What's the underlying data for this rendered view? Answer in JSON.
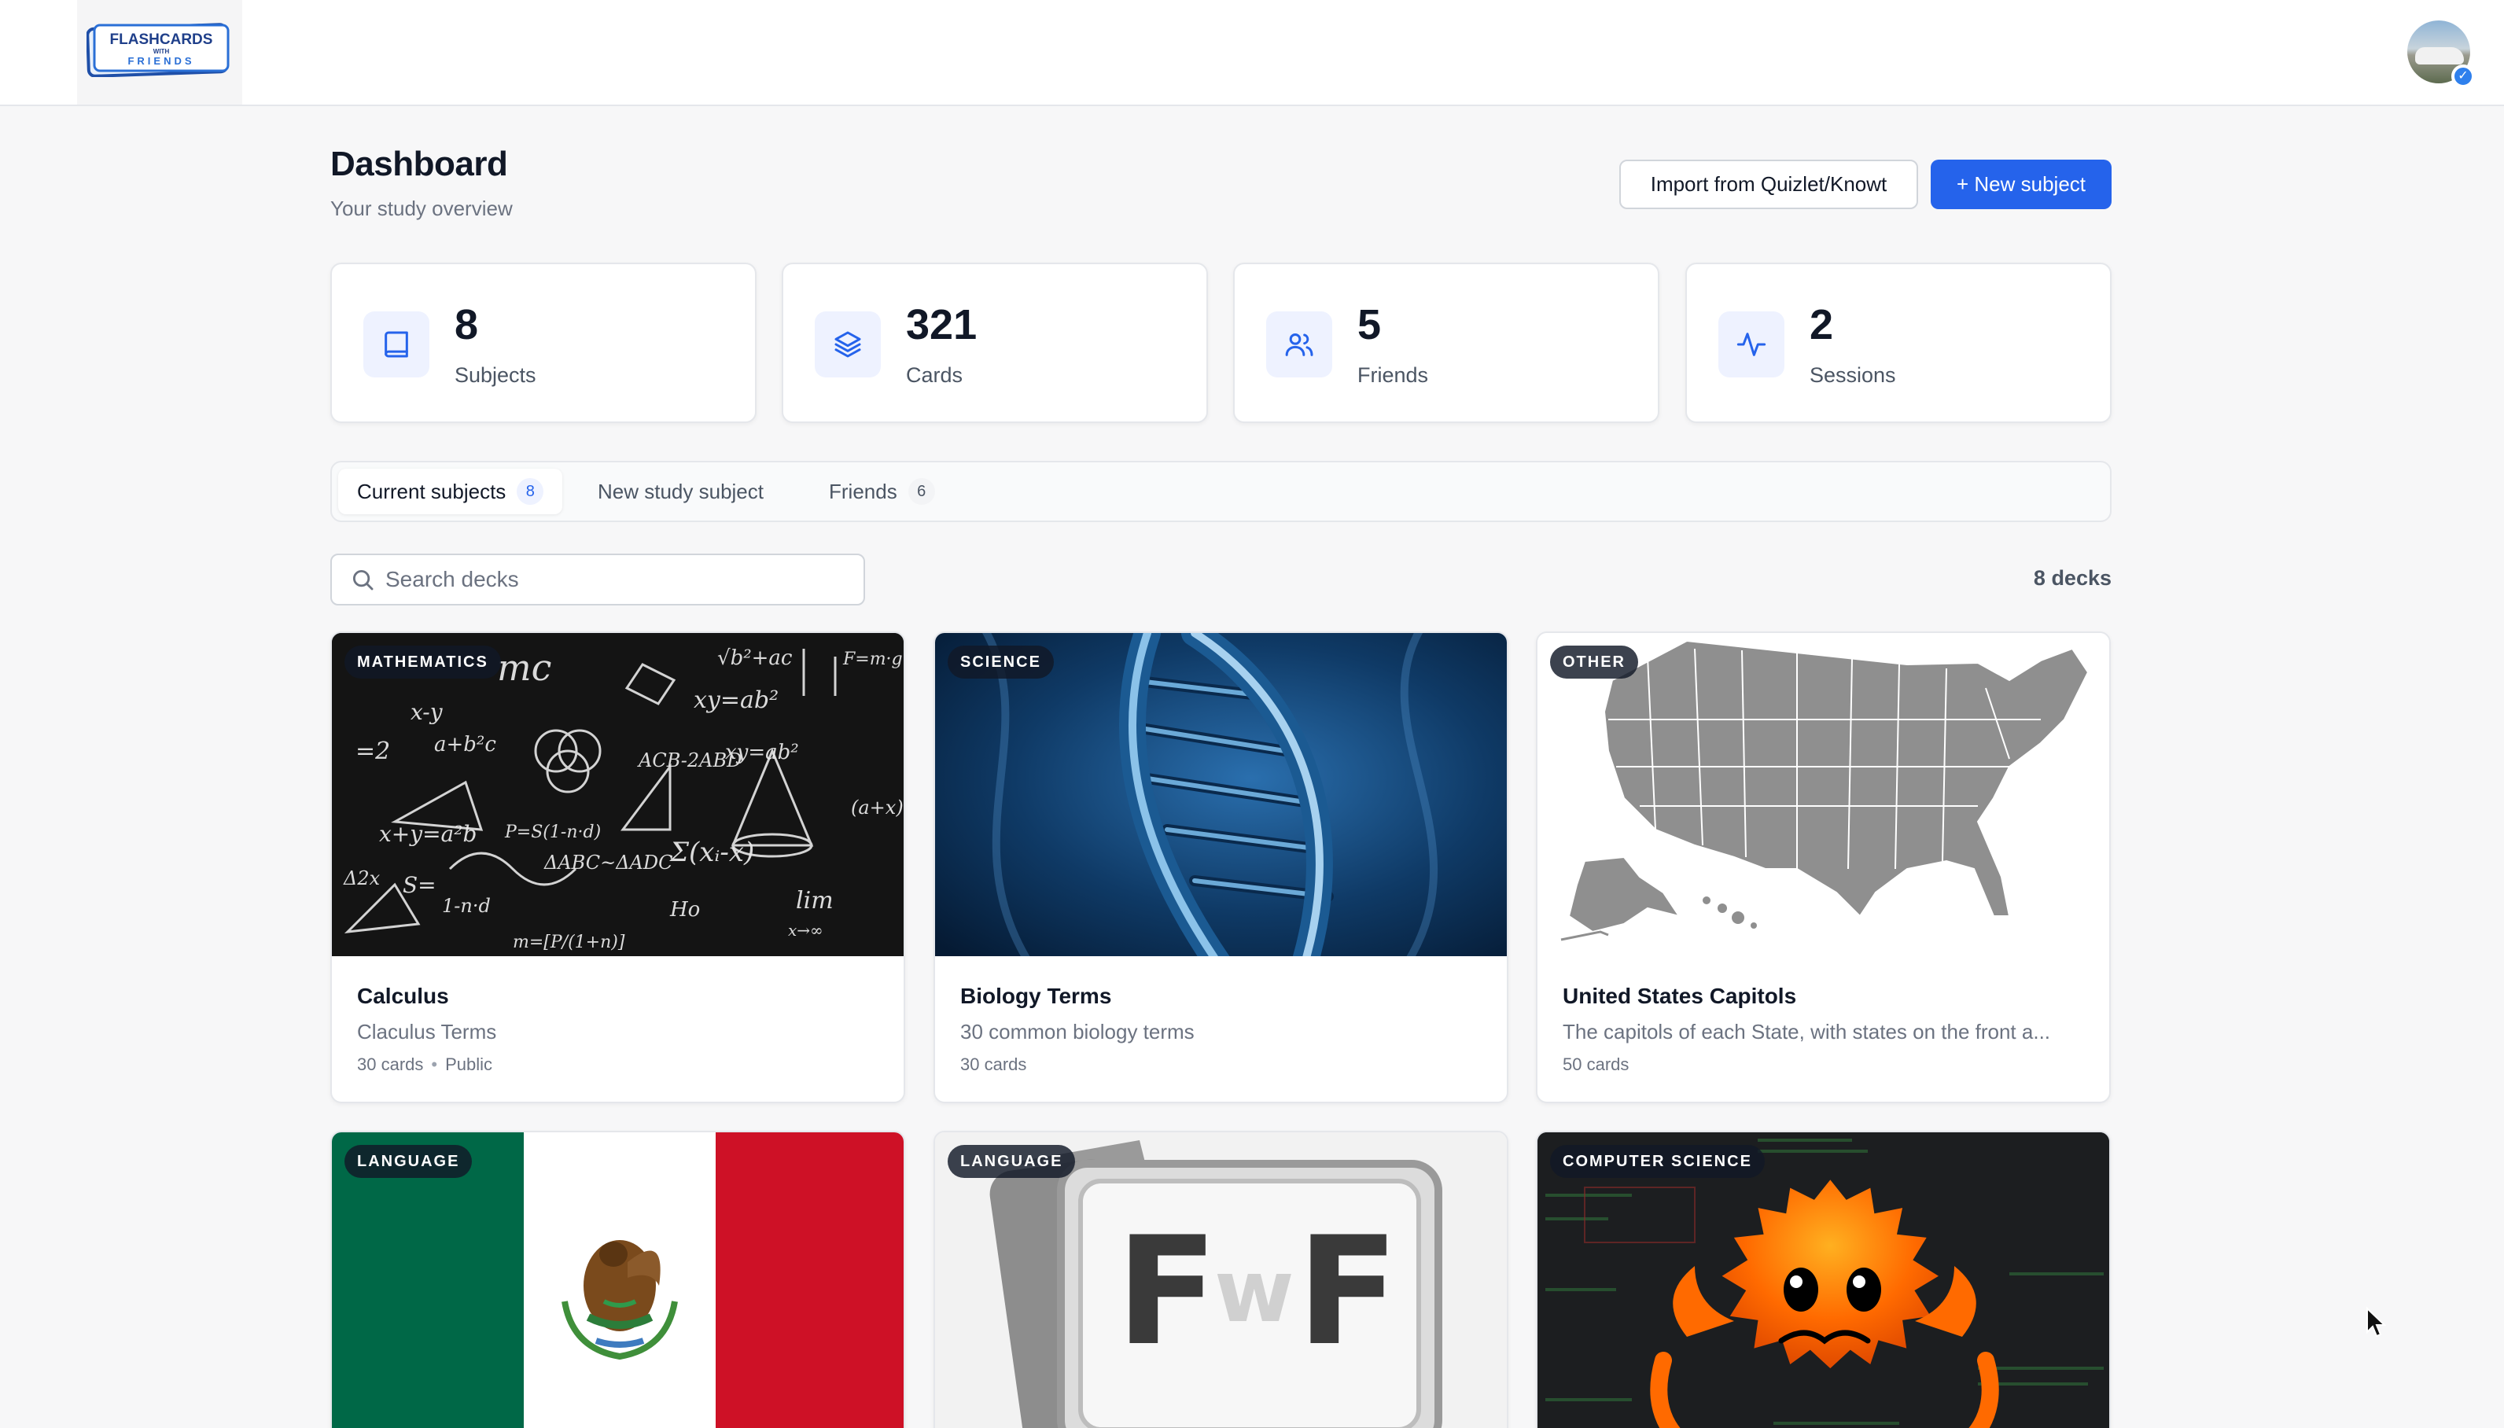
{
  "header": {
    "logo": {
      "line1": "FLASHCARDS",
      "line2": "WITH",
      "line3": "FRIENDS"
    },
    "avatar_badge": "✓"
  },
  "page": {
    "title": "Dashboard",
    "subtitle": "Your study overview"
  },
  "actions": {
    "import_label": "Import from Quizlet/Knowt",
    "new_subject_label": "+ New subject"
  },
  "stats": [
    {
      "value": "8",
      "label": "Subjects",
      "icon": "book-icon"
    },
    {
      "value": "321",
      "label": "Cards",
      "icon": "layers-icon"
    },
    {
      "value": "5",
      "label": "Friends",
      "icon": "users-icon"
    },
    {
      "value": "2",
      "label": "Sessions",
      "icon": "activity-icon"
    }
  ],
  "tabs": [
    {
      "label": "Current subjects",
      "count": "8"
    },
    {
      "label": "New study subject"
    },
    {
      "label": "Friends",
      "count": "6"
    }
  ],
  "search": {
    "placeholder": "Search decks"
  },
  "deck_count": "8 decks",
  "decks": [
    {
      "tag": "MATHEMATICS",
      "title": "Calculus",
      "description": "Claculus Terms",
      "cards": "30 cards",
      "visibility": "Public"
    },
    {
      "tag": "SCIENCE",
      "title": "Biology Terms",
      "description": "30 common biology terms",
      "cards": "30 cards"
    },
    {
      "tag": "OTHER",
      "title": "United States Capitols",
      "description": "The capitols of each State, with states on the front a...",
      "cards": "50 cards"
    },
    {
      "tag": "LANGUAGE"
    },
    {
      "tag": "LANGUAGE",
      "logo_text": {
        "left": "F",
        "middle": "w",
        "right": "F"
      }
    },
    {
      "tag": "COMPUTER SCIENCE"
    }
  ],
  "colors": {
    "accent": "#2563eb",
    "page_bg": "#f7f7f8",
    "flag_green": "#006847",
    "flag_red": "#ce1126"
  }
}
